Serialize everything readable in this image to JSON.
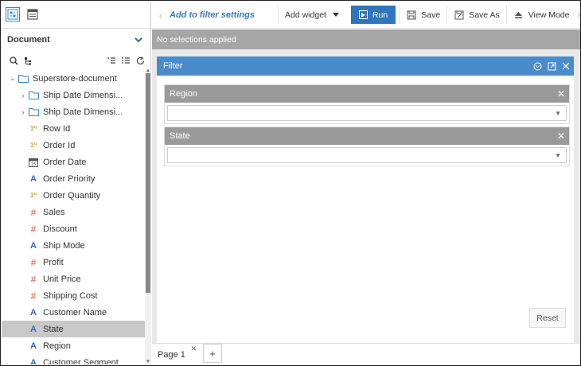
{
  "colors": {
    "accent": "#2f76bd",
    "panel_header": "#4a8ccb",
    "selection_bar": "#a6a6a6",
    "filter_header": "#9a9a9a"
  },
  "left_panel": {
    "tab_icons": [
      "dataset-icon",
      "dashboard-icon"
    ],
    "section_title": "Document",
    "tree": [
      {
        "label": "Superstore-document",
        "type": "folder",
        "level": 0,
        "expanded": true
      },
      {
        "label": "Ship Date Dimensi...",
        "type": "folder",
        "level": 1,
        "expanded": false
      },
      {
        "label": "Ship Date Dimensi...",
        "type": "folder",
        "level": 1,
        "expanded": false
      },
      {
        "label": "Row Id",
        "type": "number",
        "level": 1
      },
      {
        "label": "Order Id",
        "type": "number",
        "level": 1
      },
      {
        "label": "Order Date",
        "type": "date",
        "level": 1
      },
      {
        "label": "Order Priority",
        "type": "text",
        "level": 1
      },
      {
        "label": "Order Quantity",
        "type": "number",
        "level": 1
      },
      {
        "label": "Sales",
        "type": "measure",
        "level": 1
      },
      {
        "label": "Discount",
        "type": "measure",
        "level": 1
      },
      {
        "label": "Ship Mode",
        "type": "text",
        "level": 1
      },
      {
        "label": "Profit",
        "type": "measure",
        "level": 1
      },
      {
        "label": "Unit Price",
        "type": "measure",
        "level": 1
      },
      {
        "label": "Shipping Cost",
        "type": "measure",
        "level": 1
      },
      {
        "label": "Customer Name",
        "type": "text",
        "level": 1
      },
      {
        "label": "State",
        "type": "text",
        "level": 1,
        "selected": true
      },
      {
        "label": "Region",
        "type": "text",
        "level": 1
      },
      {
        "label": "Customer Segment",
        "type": "text",
        "level": 1
      }
    ]
  },
  "toolbar": {
    "title": "Add to filter settings",
    "add_widget": "Add widget",
    "run": "Run",
    "save": "Save",
    "save_as": "Save As",
    "view_mode": "View Mode"
  },
  "selection_bar": {
    "text": "No selections applied"
  },
  "filter_panel": {
    "title": "Filter",
    "filters": [
      {
        "name": "Region",
        "value": ""
      },
      {
        "name": "State",
        "value": ""
      }
    ],
    "reset_label": "Reset"
  },
  "pages": {
    "tabs": [
      "Page 1"
    ],
    "add_label": "+"
  }
}
